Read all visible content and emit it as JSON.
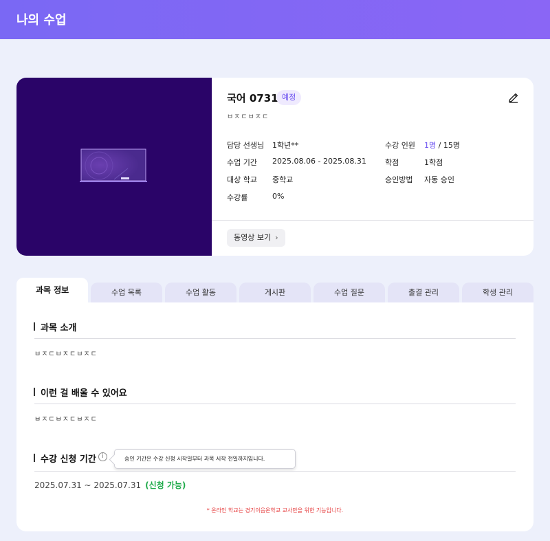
{
  "header": {
    "title": "나의 수업"
  },
  "course": {
    "title": "국어 0731",
    "status": "예정",
    "description": "ㅂㅈㄷㅂㅈㄷ",
    "edit_icon": "pencil-icon",
    "teacher_label": "담당 선생님",
    "teacher_value": "1학년**",
    "period_label": "수업 기간",
    "period_value": "2025.08.06 - 2025.08.31",
    "school_label": "대상 학교",
    "school_value": "중학교",
    "progress_label": "수강률",
    "progress_value": "0%",
    "capacity_label": "수강 인원",
    "capacity_current": "1명",
    "capacity_total": "/ 15명",
    "credit_label": "학점",
    "credit_value": "1학점",
    "approval_label": "승인방법",
    "approval_value": "자동 승인",
    "video_button": "동영상 보기",
    "thumbnail_bg": "#2a0468"
  },
  "tabs": [
    {
      "label": "과목 정보"
    },
    {
      "label": "수업 목록"
    },
    {
      "label": "수업 활동"
    },
    {
      "label": "게시판"
    },
    {
      "label": "수업 질문"
    },
    {
      "label": "출결 관리"
    },
    {
      "label": "학생 관리"
    }
  ],
  "sections": {
    "intro_title": "과목 소개",
    "intro_text": "ㅂㅈㄷㅂㅈㄷㅂㅈㄷ",
    "learn_title": "이런 걸 배울 수 있어요",
    "learn_text": "ㅂㅈㄷㅂㅈㄷㅂㅈㄷ",
    "period_title": "수강 신청 기간",
    "tooltip": "승인 기간은 수강 신청 시작일부터 과목 시작 전일까지입니다.",
    "period_range": "2025.07.31 ~ 2025.07.31",
    "period_status": "(신청 가능)",
    "notice": "* 온라인 학교는 경기이음온학교 교사만을 위한 기능입니다."
  },
  "colors": {
    "accent": "#6a4ff0",
    "header_start": "#7a68f4",
    "success": "#1faa4a",
    "notice": "#e5393a"
  }
}
